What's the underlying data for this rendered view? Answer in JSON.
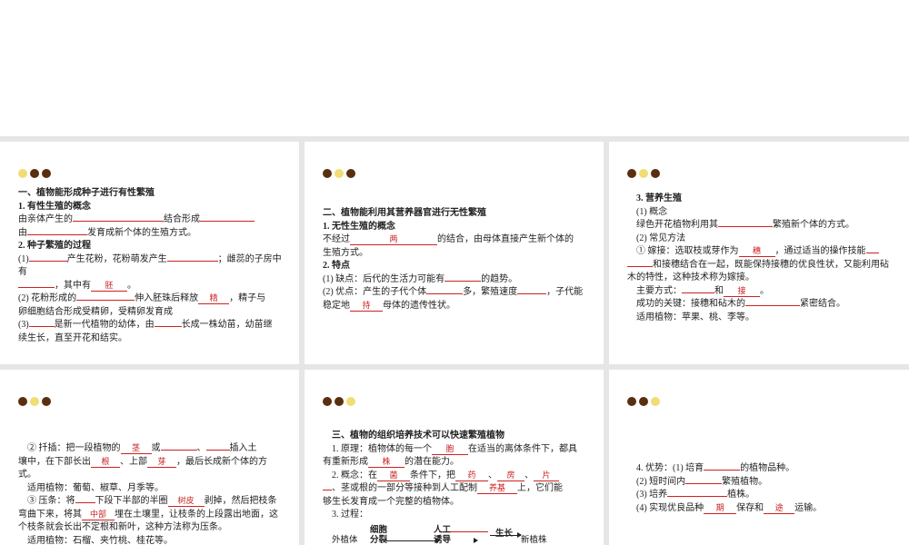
{
  "card1": {
    "s1_title": "一、植物能形成种子进行有性繁殖",
    "s1_1": "1. 有性生殖的概念",
    "l1a": "由亲体产生的",
    "l1b": "结合形成",
    "l2a": "由",
    "l2b": "发育成新个体的生殖方式。",
    "s1_2": "2. 种子繁殖的过程",
    "l3a": "(1)",
    "l3b": "产生花粉，花粉萌发产生",
    "l3c": "；雌蕊的子房中有",
    "l4a": "，其中有",
    "l4b": "胚",
    "l4c": "。",
    "l5a": "(2) 花粉形成的",
    "l5b": "伸入胚珠后释放",
    "l5c": "精",
    "l5d": "，精子与",
    "l6": "卵细胞结合形成受精卵，受精卵发育成",
    "l7a": "(3)",
    "l7b": "是新一代植物的幼体，由",
    "l7c": "长成一株幼苗，幼苗继",
    "l8": "续生长，直至开花和结实。"
  },
  "card2": {
    "s2_title": "二、植物能利用其营养器官进行无性繁殖",
    "s2_1": "1. 无性生殖的概念",
    "l1a": "不经过",
    "l1b": "两",
    "l1c": "的结合，由母体直接产生新个体的",
    "l2": "生殖方式。",
    "s2_2": "2. 特点",
    "l3a": "(1) 缺点：后代的生活力可能有",
    "l3b": "的趋势。",
    "l4a": "(2) 优点：产生的子代个体",
    "l4b": "多，繁殖速度",
    "l4c": "，子代能",
    "l5a": "稳定地",
    "l5b": "持",
    "l5c": "母体的遗传性状。"
  },
  "card3": {
    "s3_title": "3. 营养生殖",
    "p1": "(1) 概念",
    "l1a": "绿色开花植物利用其",
    "l1b": "繁殖新个体的方式。",
    "p2": "(2) 常见方法",
    "l2a": "① 嫁接：选取枝或芽作为",
    "l2b": "穗",
    "l2c": "，通过适当的操作技能",
    "l3a": "和接穗结合在一起，既能保持接穗的优良性状，又能利用砧",
    "l4": "木的特性，这种技术称为嫁接。",
    "l5a": "主要方式：",
    "l5b": "和",
    "l5c": "接",
    "l5d": "。",
    "l6a": "成功的关键：接穗和砧木的",
    "l6b": "紧密结合。",
    "l7": "适用植物：苹果、桃、李等。"
  },
  "card4": {
    "l1a": "② 扦插：把一段植物的",
    "l1b": "茎",
    "l1c": "或",
    "l1d": "、",
    "l1e": "插入土",
    "l2a": "壤中，在下部长出",
    "l2b": "根",
    "l2c": "、上部",
    "l2d": "芽",
    "l2e": "，最后长成新个体的方",
    "l3": "式。",
    "l4": "适用植物：葡萄、椒草、月季等。",
    "l5a": "③ 压条：将",
    "l5b": "下段下半部的半圈",
    "l5c": "树皮",
    "l5d": "剥掉，然后把枝条",
    "l6a": "弯曲下来，将其",
    "l6b": "中部",
    "l6c": "埋在土壤里，让枝条的上段露出地面，这",
    "l7": "个枝条就会长出不定根和新叶，这种方法称为压条。",
    "l8": "适用植物：石榴、夹竹桃、桂花等。"
  },
  "card5": {
    "s_title": "三、植物的组织培养技术可以快速繁殖植物",
    "l1a": "1. 原理：植物体的每一个",
    "l1b": "胞",
    "l1c": "在适当的离体条件下，都具",
    "l2a": "有重新形成",
    "l2b": "株",
    "l2c": "的潜在能力。",
    "l3a": "2. 概念：在",
    "l3b": "菌",
    "l3c": "条件下，把",
    "l3d": "药",
    "l3e": "、",
    "l3f": "房",
    "l3g": "、",
    "l3h": "片",
    "l4a": "、茎或根的一部分等接种到人工配制",
    "l4b": "养基",
    "l4c": "上，它们能",
    "l5": "够生长发育成一个完整的植物体。",
    "l6": "3. 过程：",
    "d_top1": "细胞",
    "d_bot1": "分裂",
    "d_top2": "人工",
    "d_bot2": "诱导",
    "d_top3": "生长",
    "d_start": "外植体",
    "d_end": "新植株"
  },
  "card6": {
    "l1a": "4. 优势：(1) 培育",
    "l1b": "的植物品种。",
    "l2a": "(2) 短时间内",
    "l2b": "繁殖植物。",
    "l3a": "(3) 培养",
    "l3b": "植株。",
    "l4a": "(4) 实现优良品种",
    "l4b": "期",
    "l4c": "保存和",
    "l4d": "途",
    "l4e": "运输。"
  }
}
